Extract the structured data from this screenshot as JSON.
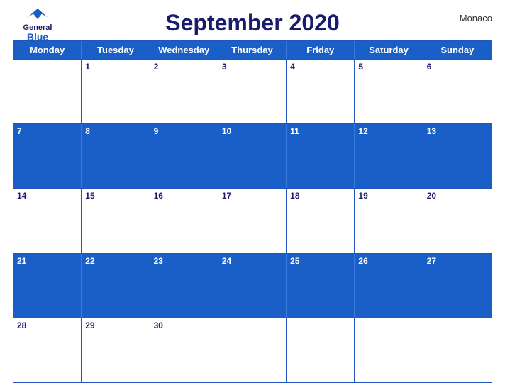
{
  "header": {
    "title": "September 2020",
    "country": "Monaco",
    "logo": {
      "general": "General",
      "blue": "Blue"
    }
  },
  "days": [
    "Monday",
    "Tuesday",
    "Wednesday",
    "Thursday",
    "Friday",
    "Saturday",
    "Sunday"
  ],
  "weeks": [
    {
      "isBlue": false,
      "cells": [
        {
          "date": "",
          "empty": true
        },
        {
          "date": "1"
        },
        {
          "date": "2"
        },
        {
          "date": "3"
        },
        {
          "date": "4"
        },
        {
          "date": "5"
        },
        {
          "date": "6"
        }
      ]
    },
    {
      "isBlue": true,
      "cells": [
        {
          "date": "7"
        },
        {
          "date": "8"
        },
        {
          "date": "9"
        },
        {
          "date": "10"
        },
        {
          "date": "11"
        },
        {
          "date": "12"
        },
        {
          "date": "13"
        }
      ]
    },
    {
      "isBlue": false,
      "cells": [
        {
          "date": "14"
        },
        {
          "date": "15"
        },
        {
          "date": "16"
        },
        {
          "date": "17"
        },
        {
          "date": "18"
        },
        {
          "date": "19"
        },
        {
          "date": "20"
        }
      ]
    },
    {
      "isBlue": true,
      "cells": [
        {
          "date": "21"
        },
        {
          "date": "22"
        },
        {
          "date": "23"
        },
        {
          "date": "24"
        },
        {
          "date": "25"
        },
        {
          "date": "26"
        },
        {
          "date": "27"
        }
      ]
    },
    {
      "isBlue": false,
      "cells": [
        {
          "date": "28"
        },
        {
          "date": "29"
        },
        {
          "date": "30"
        },
        {
          "date": "",
          "empty": true
        },
        {
          "date": "",
          "empty": true
        },
        {
          "date": "",
          "empty": true
        },
        {
          "date": "",
          "empty": true
        }
      ]
    }
  ]
}
